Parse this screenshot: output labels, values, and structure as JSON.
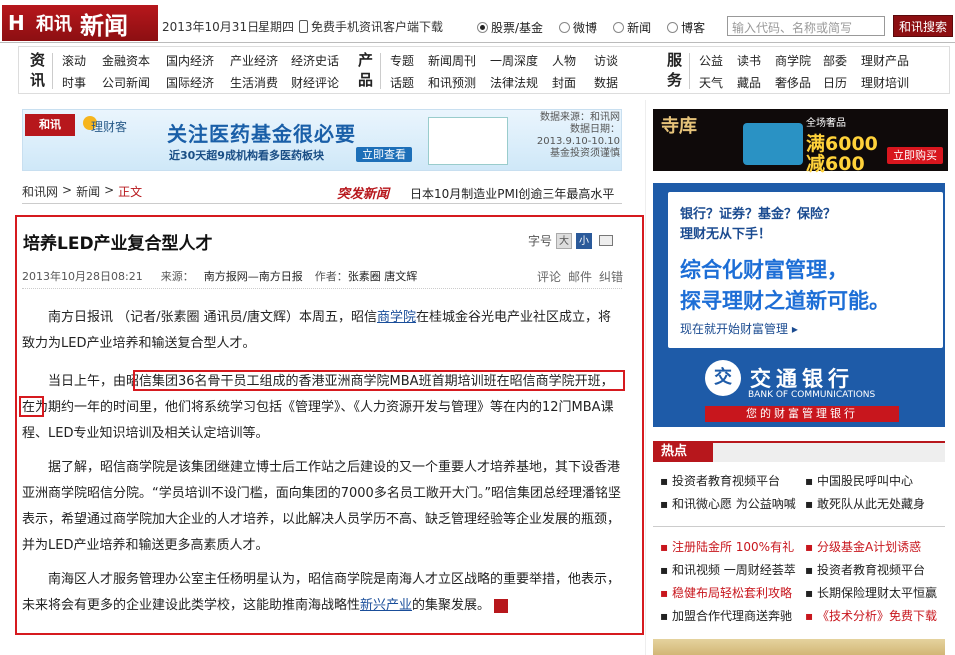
{
  "header": {
    "logo_mark": "H",
    "logo_brand": "和讯",
    "logo_section": "新闻",
    "date": "2013年10月31日",
    "weekday": "星期四",
    "phone_link": "免费手机资讯客户端下载",
    "radios": [
      "股票/基金",
      "微博",
      "新闻",
      "博客"
    ],
    "search_placeholder": "输入代码、名称或简写",
    "search_button": "和讯搜索"
  },
  "nav": {
    "group1_head": "资讯",
    "group1_row1": [
      "滚动",
      "金融资本",
      "国内经济",
      "产业经济",
      "经济史话"
    ],
    "group1_row2": [
      "时事",
      "公司新闻",
      "国际经济",
      "生活消费",
      "财经评论"
    ],
    "group2_head": "产品",
    "group2_row1": [
      "专题",
      "新闻周刊",
      "一周深度",
      "人物",
      "访谈"
    ],
    "group2_row2": [
      "话题",
      "和讯预测",
      "法律法规",
      "封面",
      "数据"
    ],
    "group3_head": "服务",
    "group3_row1": [
      "公益",
      "读书",
      "商学院",
      "部委",
      "理财产品"
    ],
    "group3_row2": [
      "天气",
      "藏品",
      "奢侈品",
      "日历",
      "理财培训"
    ]
  },
  "banner": {
    "logo": "和讯",
    "brand": "理财客",
    "headline": "关注医药基金很必要",
    "sub": "近30天超9成机构看多医药板块",
    "button": "立即查看",
    "note1": "数据来源：和讯网",
    "note2": "数据日期：2013.9.10-10.10",
    "note3": "基金投资须谨慎"
  },
  "breadcrumb": {
    "home": "和讯网",
    "sep1": ">",
    "section": "新闻",
    "sep2": ">",
    "current": "正文"
  },
  "hot_news": {
    "tag": "突发新闻",
    "text": "日本10月制造业PMI创逾三年最高水平"
  },
  "article": {
    "title": "培养LED产业复合型人才",
    "font_label": "字号",
    "font_big": "大",
    "font_small": "小",
    "datetime": "2013年10月28日08:21",
    "source_label": "来源：",
    "source": "南方报网—南方日报",
    "author_label": "作者：",
    "author": "张素圈 唐文辉",
    "tools": [
      "评论",
      "邮件",
      "纠错"
    ],
    "p1_a": "南方日报讯 （记者/张素圈 通讯员/唐文辉）本周五，昭信",
    "p1_link": "商学院",
    "p1_b": "在桂城金谷光电产业社区成立，将致力为LED产业培养和输送复合型人才。",
    "p2": "当日上午，由昭信集团36名骨干员工组成的香港亚洲商学院MBA班首期培训班在昭信商学院开班，在为期约一年的时间里，他们将系统学习包括《管理学》、《人力资源开发与管理》等在内的12门MBA课程、LED专业知识培训及相关认定培训等。",
    "p3": "据了解，昭信商学院是该集团继建立博士后工作站之后建设的又一个重要人才培养基地，其下设香港亚洲商学院昭信分院。“学员培训不设门槛，面向集团的7000多名员工敞开大门。”昭信集团总经理潘铭坚表示，希望通过商学院加大企业的人才培养，以此解决人员学历不高、缺乏管理经验等企业发展的瓶颈，并为LED产业培养和输送更多高素质人才。",
    "p4_a": "南海区人才服务管理办公室主任杨明星认为，昭信商学院是南海人才立区战略的重要举措，他表示，未来将会有更多的企业建设此类学校，这能助推南海战略性",
    "p4_link": "新兴产业",
    "p4_b": "的集聚发展。",
    "end_mark": "H"
  },
  "ad_top": {
    "logo": "寺库",
    "small": "全场奢品",
    "line1": "满6000",
    "line2": "减600",
    "button": "立即购买"
  },
  "ad_bank": {
    "q1": "银行？证券？基金？保险？",
    "q2": "理财无从下手！",
    "h1": "综合化财富管理，",
    "h2": "探寻理财之道新可能。",
    "link": "现在就开始财富管理 ▸",
    "logo": "交",
    "name": "交通银行",
    "en": "BANK OF COMMUNICATIONS",
    "slogan": "您的财富管理银行"
  },
  "hot": {
    "head": "热点",
    "group1": [
      "投资者教育视频平台",
      "中国股民呼叫中心",
      "和讯微心愿 为公益吶喊",
      "敢死队从此无处藏身"
    ],
    "group2": [
      "注册陆金所 100%有礼",
      "分级基金A计划诱惑",
      "和讯视频 一周财经荟萃",
      "投资者教育视频平台",
      "稳健布局轻松套利攻略",
      "长期保险理财太平恒赢",
      "加盟合作代理商送奔驰",
      "《技术分析》免费下载"
    ]
  },
  "colors": {
    "brand_red": "#b7171c",
    "highlight_red": "#d61a1f",
    "link_blue": "#1a4e9a",
    "bank_blue": "#1e5ba8"
  }
}
